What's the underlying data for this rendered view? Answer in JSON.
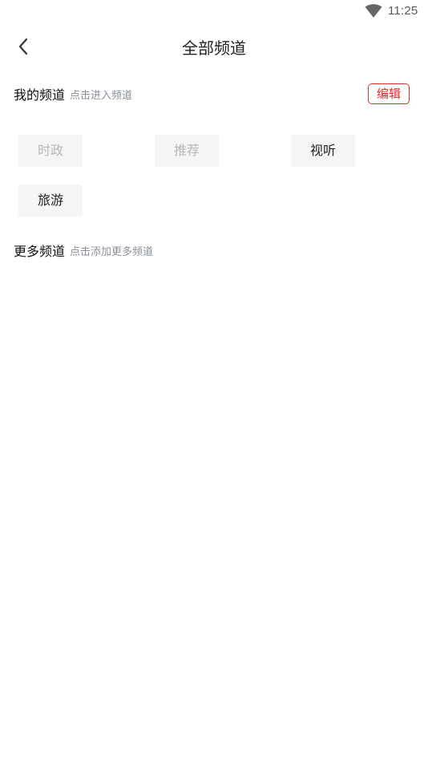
{
  "status_bar": {
    "time": "11:25",
    "wifi_icon": "wifi-icon"
  },
  "nav": {
    "back_icon": "chevron-left-icon",
    "title": "全部频道"
  },
  "my_channels": {
    "title": "我的频道",
    "hint": "点击进入频道",
    "edit_label": "编辑",
    "items": [
      {
        "label": "时政",
        "fixed": true
      },
      {
        "label": "推荐",
        "fixed": true
      },
      {
        "label": "视听",
        "fixed": false
      },
      {
        "label": "旅游",
        "fixed": false
      }
    ]
  },
  "more_channels": {
    "title": "更多频道",
    "hint": "点击添加更多频道"
  },
  "colors": {
    "accent": "#d8352a",
    "chip_bg": "#f5f5f5",
    "hint": "#8a8f99",
    "fixed_text": "#b7b7b7"
  }
}
